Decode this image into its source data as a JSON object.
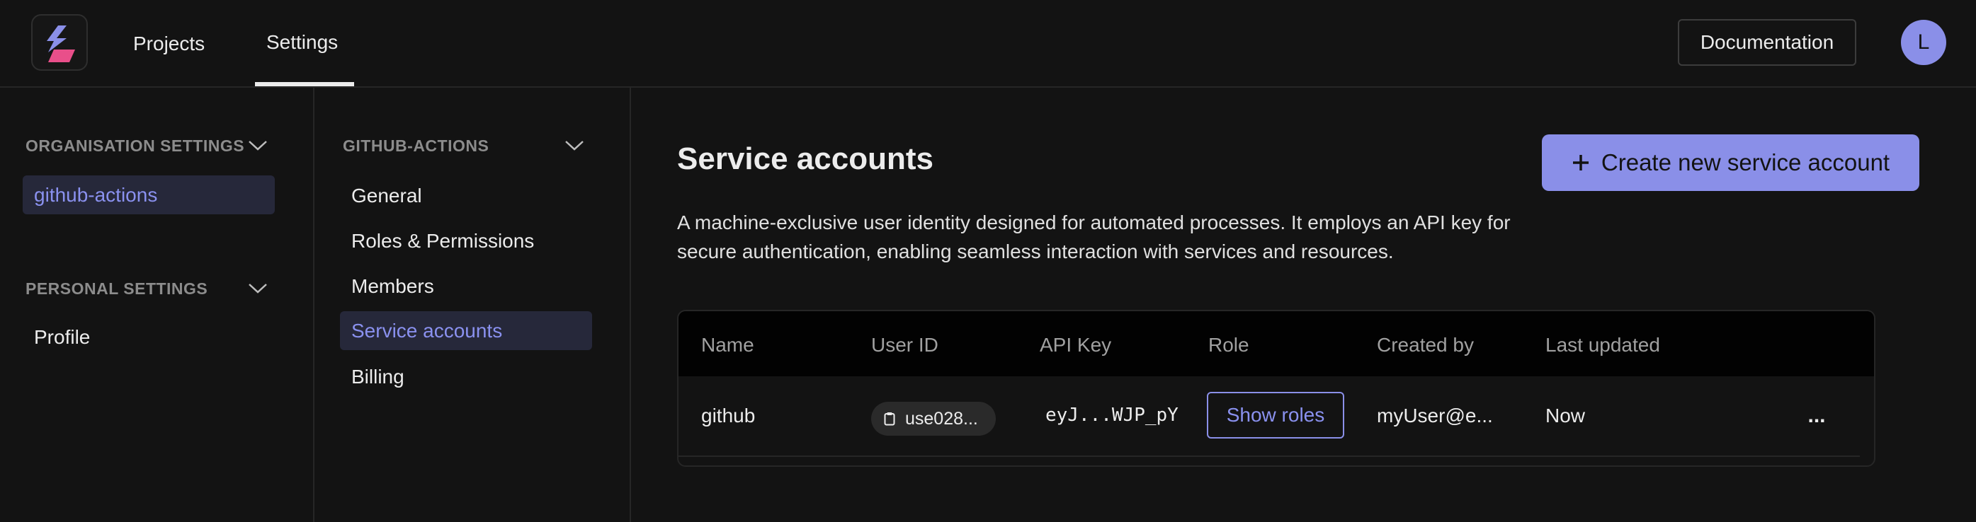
{
  "topbar": {
    "nav": [
      {
        "label": "Projects"
      },
      {
        "label": "Settings"
      }
    ],
    "documentation_label": "Documentation",
    "avatar_initial": "L"
  },
  "sidebar": {
    "org_heading": "ORGANISATION SETTINGS",
    "org_items": [
      {
        "label": "github-actions",
        "active": true
      }
    ],
    "personal_heading": "PERSONAL SETTINGS",
    "personal_items": [
      {
        "label": "Profile"
      }
    ]
  },
  "subnav": {
    "heading": "GITHUB-ACTIONS",
    "items": [
      {
        "label": "General"
      },
      {
        "label": "Roles & Permissions"
      },
      {
        "label": "Members"
      },
      {
        "label": "Service accounts",
        "active": true
      },
      {
        "label": "Billing"
      }
    ]
  },
  "main": {
    "title": "Service accounts",
    "description": "A machine-exclusive user identity designed for automated processes. It employs an API key for secure authentication, enabling seamless interaction with services and resources.",
    "create_label": "Create new service account",
    "table": {
      "columns": [
        "Name",
        "User ID",
        "API Key",
        "Role",
        "Created by",
        "Last updated"
      ],
      "rows": [
        {
          "name": "github",
          "user_id": "use028...",
          "api_key": "eyJ...WJP_pY",
          "role_button": "Show roles",
          "created_by": "myUser@e...",
          "last_updated": "Now",
          "more": "..."
        }
      ]
    }
  },
  "colors": {
    "background": "#131313",
    "accent": "#8a8fe8",
    "active_bg": "#26283a",
    "header_bg": "#020202",
    "border": "#262626"
  },
  "icons": [
    "app-logo-icon",
    "chevron-down-icon",
    "plus-icon",
    "clipboard-icon",
    "more-horizontal-icon"
  ]
}
